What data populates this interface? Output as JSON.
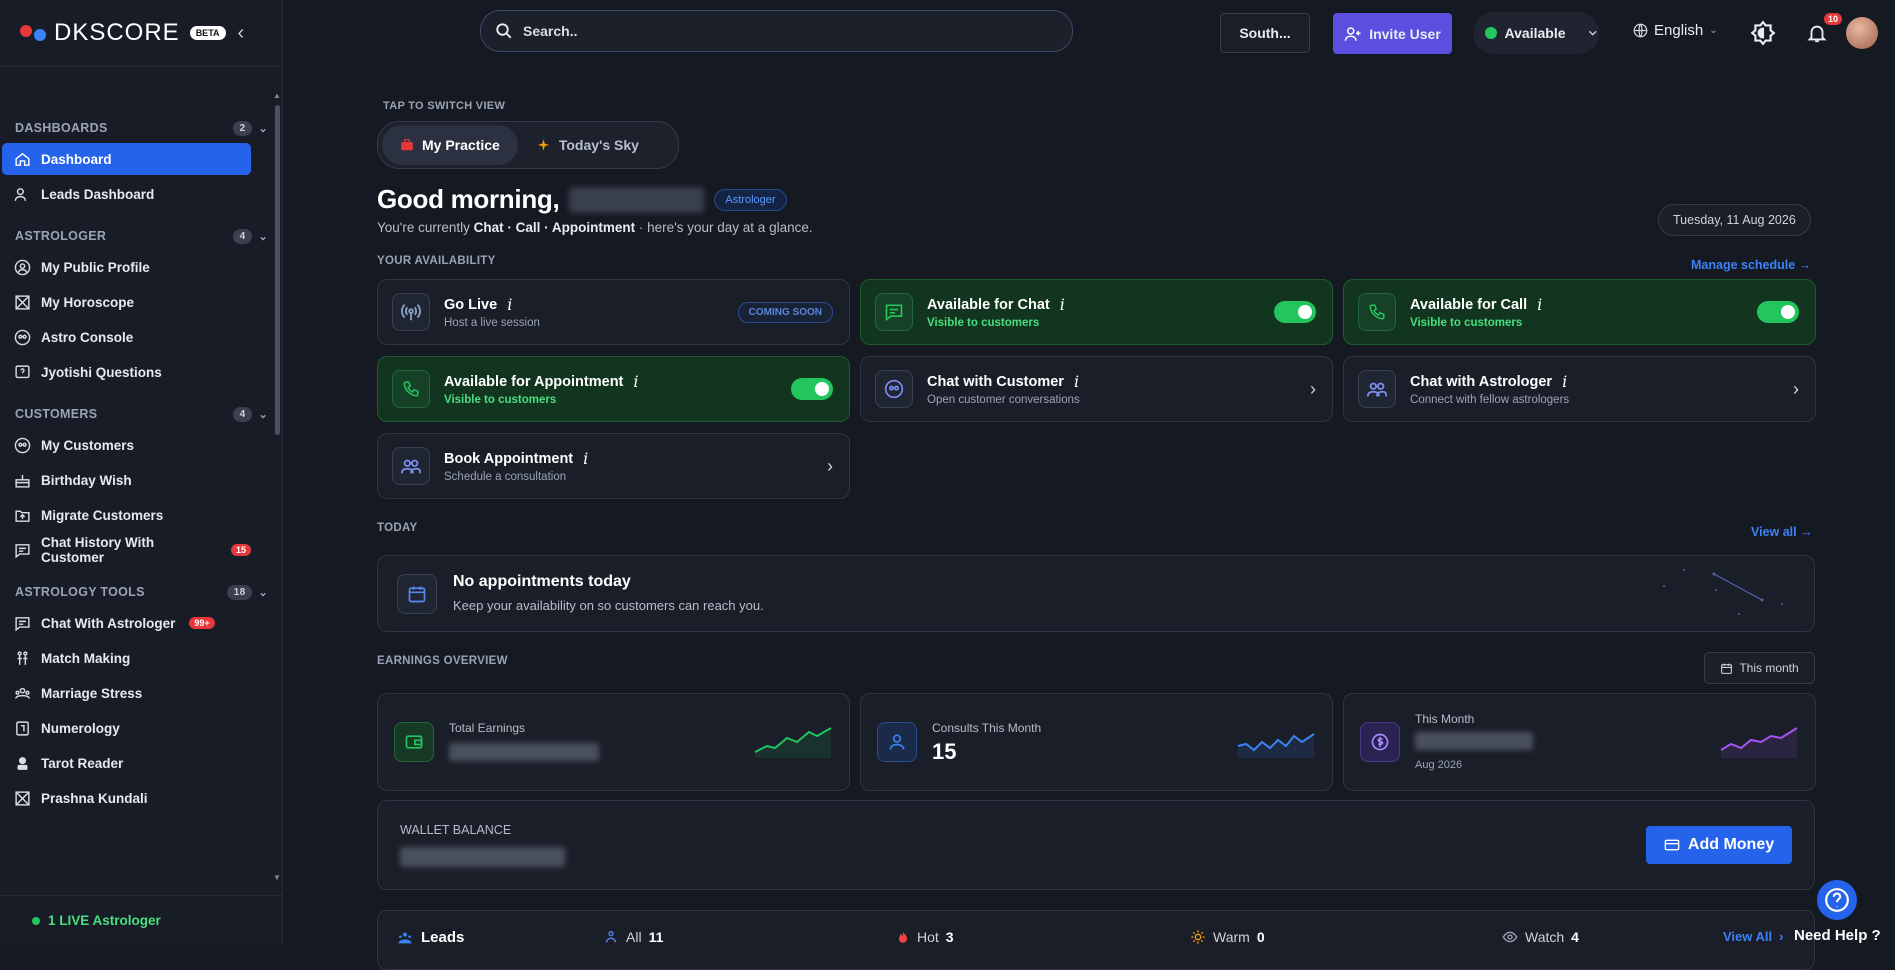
{
  "app": {
    "name": "DKSCORE",
    "beta": "BETA"
  },
  "sidebar": {
    "sections": [
      {
        "title": "DASHBOARDS",
        "count": "2",
        "items": [
          {
            "label": "Dashboard"
          },
          {
            "label": "Leads Dashboard"
          }
        ]
      },
      {
        "title": "ASTROLOGER",
        "count": "4",
        "items": [
          {
            "label": "My Public Profile"
          },
          {
            "label": "My Horoscope"
          },
          {
            "label": "Astro Console"
          },
          {
            "label": "Jyotishi Questions"
          }
        ]
      },
      {
        "title": "CUSTOMERS",
        "count": "4",
        "items": [
          {
            "label": "My Customers"
          },
          {
            "label": "Birthday Wish"
          },
          {
            "label": "Migrate Customers"
          },
          {
            "label": "Chat History With Customer",
            "badge": "15"
          }
        ]
      },
      {
        "title": "ASTROLOGY TOOLS",
        "count": "18",
        "items": [
          {
            "label": "Chat With Astrologer",
            "badge": "99+"
          },
          {
            "label": "Match Making"
          },
          {
            "label": "Marriage Stress"
          },
          {
            "label": "Numerology"
          },
          {
            "label": "Tarot Reader"
          },
          {
            "label": "Prashna Kundali"
          }
        ]
      }
    ],
    "footer": "1 LIVE Astrologer"
  },
  "topbar": {
    "search_placeholder": "Search..",
    "region": "South...",
    "invite_label": "Invite User",
    "status": "Available",
    "language": "English",
    "notifications": "10"
  },
  "main": {
    "switch_label": "TAP TO SWITCH VIEW",
    "tabs": [
      "My Practice",
      "Today's Sky"
    ],
    "greeting": "Good morning,",
    "role": "Astrologer",
    "subtitle_prefix": "You're currently",
    "subtitle_modes": "Chat · Call · Appointment",
    "subtitle_suffix": "· here's your day at a glance.",
    "date": "Tuesday, 11 Aug 2026",
    "availability_label": "YOUR AVAILABILITY",
    "manage_link": "Manage schedule →",
    "cards": {
      "go_live": {
        "title": "Go Live",
        "sub": "Host a live session",
        "tag": "COMING SOON"
      },
      "chat": {
        "title": "Available for Chat",
        "sub": "Visible to customers"
      },
      "call": {
        "title": "Available for Call",
        "sub": "Visible to customers"
      },
      "appointment": {
        "title": "Available for Appointment",
        "sub": "Visible to customers"
      },
      "chat_customer": {
        "title": "Chat with Customer",
        "sub": "Open customer conversations"
      },
      "chat_astrologer": {
        "title": "Chat with Astrologer",
        "sub": "Connect with fellow astrologers"
      },
      "book": {
        "title": "Book Appointment",
        "sub": "Schedule a consultation"
      }
    },
    "today_label": "TODAY",
    "view_all": "View all →",
    "no_appt_title": "No appointments today",
    "no_appt_sub": "Keep your availability on so customers can reach you.",
    "earnings_label": "EARNINGS OVERVIEW",
    "period": "This month",
    "earnings": {
      "total": {
        "label": "Total Earnings"
      },
      "consults": {
        "label": "Consults This Month",
        "value": "15"
      },
      "month": {
        "label": "This Month",
        "sub": "Aug 2026"
      }
    },
    "wallet_label": "WALLET BALANCE",
    "add_money": "Add Money",
    "leads": {
      "title": "Leads",
      "all_label": "All",
      "all": "11",
      "hot_label": "Hot",
      "hot": "3",
      "warm_label": "Warm",
      "warm": "0",
      "watch_label": "Watch",
      "watch": "4",
      "view_all": "View All"
    },
    "help": "Need Help ?"
  },
  "colors": {
    "accent": "#2563eb",
    "green": "#22c55e",
    "invite": "#5b4fe0",
    "bg": "#151922"
  }
}
